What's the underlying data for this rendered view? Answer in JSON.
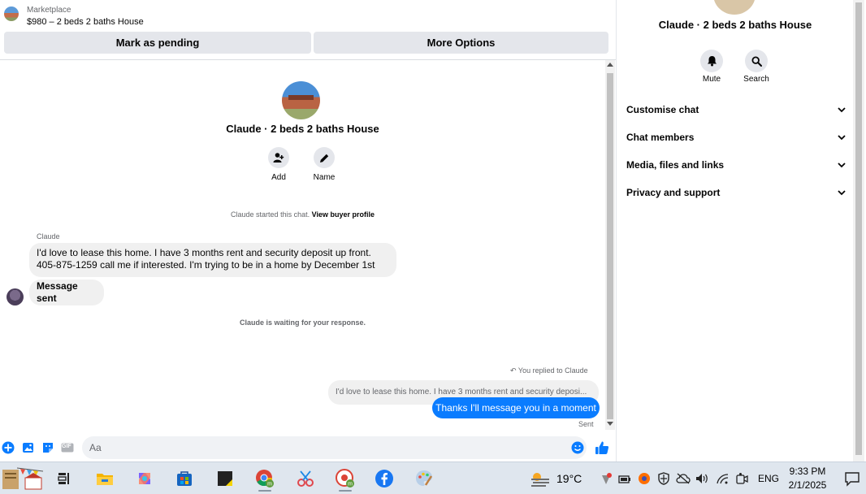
{
  "marketplace": {
    "label": "Marketplace",
    "listing": "$980 – 2 beds 2 baths House"
  },
  "actions": {
    "mark_pending": "Mark as pending",
    "more_options": "More Options"
  },
  "chat": {
    "title": "Claude · 2 beds 2 baths House",
    "add_label": "Add",
    "name_label": "Name",
    "started_note": "Claude started this chat.",
    "view_buyer_profile": "View buyer profile",
    "sender_name": "Claude",
    "incoming_message_line1": "I'd love to lease this home.  I have 3 months  rent  and security deposit up front.",
    "incoming_message_line2": "405-875-1259 call me if interested.  I'm trying to be in a home by December 1st",
    "message_sent": "Message sent",
    "waiting_note": "Claude is waiting for your response.",
    "replied_note": "You replied to Claude",
    "quoted_reply": "I'd love to lease this home.  I have 3 months  rent  and security deposi...",
    "outgoing_message": "Thanks I'll message you in a moment",
    "sent_status": "Sent"
  },
  "composer": {
    "placeholder": "Aa",
    "gif_label": "GIF"
  },
  "info_panel": {
    "title": "Claude · 2 beds 2 baths House",
    "mute_label": "Mute",
    "search_label": "Search",
    "sections": [
      {
        "label": "Customise chat"
      },
      {
        "label": "Chat members"
      },
      {
        "label": "Media, files and links"
      },
      {
        "label": "Privacy and support"
      }
    ]
  },
  "taskbar": {
    "temperature": "19°C",
    "language": "ENG",
    "time": "9:33 PM",
    "date": "2/1/2025"
  },
  "colors": {
    "accent": "#0a7cff",
    "bubble_in": "#f0f0f0",
    "button_gray": "#e4e6eb"
  }
}
